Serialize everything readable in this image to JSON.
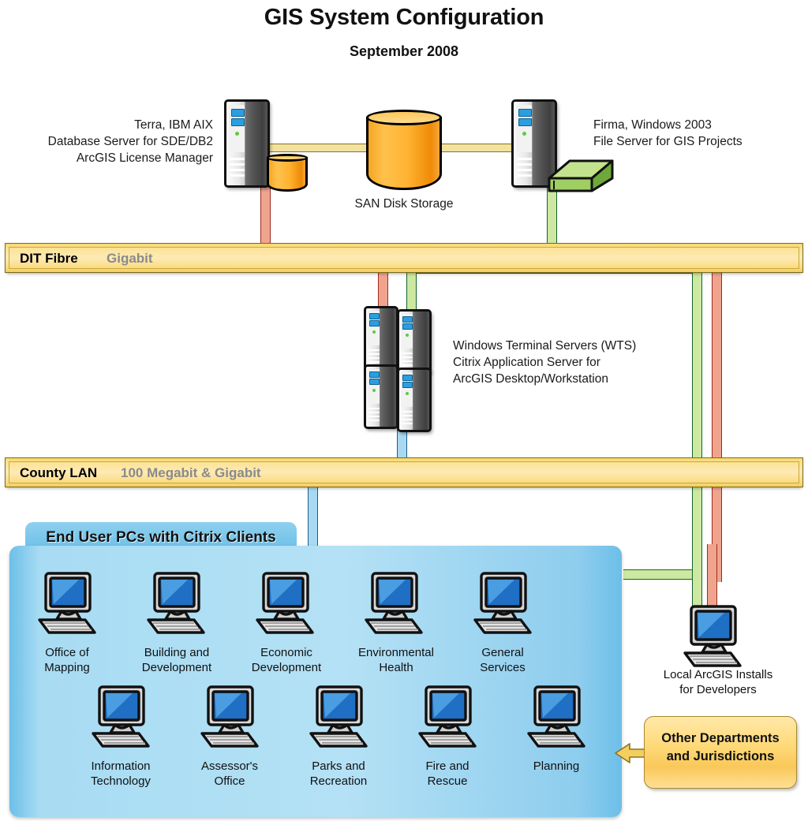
{
  "header": {
    "title": "GIS System Configuration",
    "subtitle": "September 2008"
  },
  "nodes": {
    "db_server": {
      "name": "database-server",
      "label_lines": [
        "Terra, IBM AIX",
        "Database Server for SDE/DB2",
        "ArcGIS License Manager"
      ],
      "label": "Terra, IBM AIX\nDatabase Server for SDE/DB2\nArcGIS License Manager"
    },
    "san": {
      "name": "san-disk-storage",
      "label": "SAN Disk Storage"
    },
    "file_server": {
      "name": "file-server",
      "label_lines": [
        "Firma, Windows 2003",
        "File Server for GIS Projects"
      ],
      "label": "Firma, Windows 2003\nFile Server for GIS Projects"
    },
    "wts": {
      "name": "windows-terminal-servers",
      "label_lines": [
        "Windows Terminal Servers (WTS)",
        "Citrix Application Server for",
        "ArcGIS Desktop/Workstation"
      ],
      "label": "Windows Terminal Servers (WTS)\nCitrix Application Server for\nArcGIS Desktop/Workstation"
    },
    "developer_pc": {
      "name": "developer-workstation",
      "label": "Local ArcGIS Installs\nfor Developers",
      "label_lines": [
        "Local ArcGIS Installs",
        "for Developers"
      ]
    },
    "other_departments": {
      "name": "other-departments-box",
      "label": "Other Departments\nand Jurisdictions",
      "label_lines": [
        "Other Departments",
        "and Jurisdictions"
      ]
    }
  },
  "networks": [
    {
      "id": "dit-fibre",
      "name": "DIT Fibre",
      "speed": "Gigabit"
    },
    {
      "id": "county-lan",
      "name": "County LAN",
      "speed": "100 Megabit & Gigabit"
    }
  ],
  "end_user_panel": {
    "tab_label": "End User PCs with Citrix Clients",
    "row1": [
      {
        "label": "Office of\nMapping",
        "lines": [
          "Office of",
          "Mapping"
        ]
      },
      {
        "label": "Building and\nDevelopment",
        "lines": [
          "Building and",
          "Development"
        ]
      },
      {
        "label": "Economic\nDevelopment",
        "lines": [
          "Economic",
          "Development"
        ]
      },
      {
        "label": "Environmental\nHealth",
        "lines": [
          "Environmental",
          "Health"
        ]
      },
      {
        "label": "General\nServices",
        "lines": [
          "General",
          "Services"
        ]
      }
    ],
    "row2": [
      {
        "label": "Information\nTechnology",
        "lines": [
          "Information",
          "Technology"
        ]
      },
      {
        "label": "Assessor's\nOffice",
        "lines": [
          "Assessor's",
          "Office"
        ]
      },
      {
        "label": "Parks and\nRecreation",
        "lines": [
          "Parks and",
          "Recreation"
        ]
      },
      {
        "label": "Fire and\nRescue",
        "lines": [
          "Fire and",
          "Rescue"
        ]
      },
      {
        "label": "Planning",
        "lines": [
          "Planning"
        ]
      }
    ]
  },
  "colors": {
    "cable_red": "#f0a48e",
    "cable_green": "#cde8a0",
    "cable_blue": "#a9d9f2",
    "cable_yellow": "#f2e2a0",
    "network_bar": "#fde39a",
    "panel_blue": "#b4e1f5",
    "san_orange": "#ffb331",
    "box_yellow": "#ffda7a"
  }
}
